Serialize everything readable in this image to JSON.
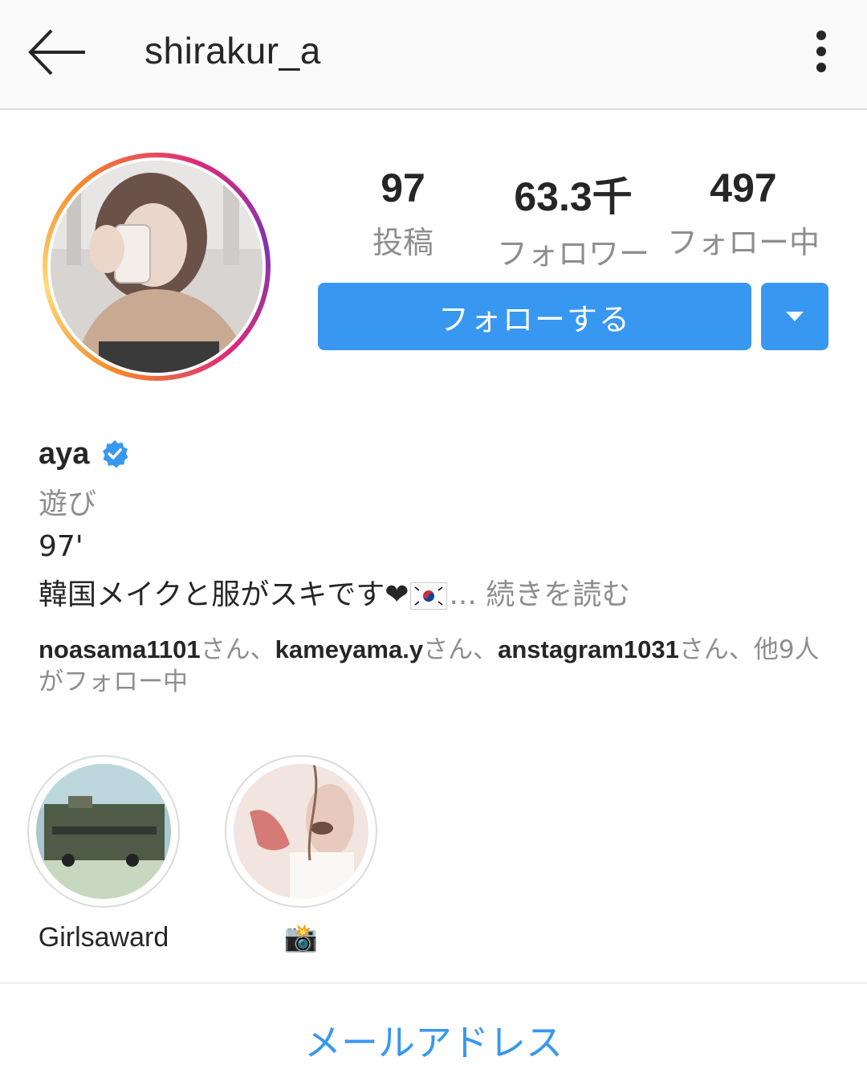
{
  "header": {
    "username": "shirakur_a",
    "back_icon": "back-arrow-icon",
    "more_icon": "more-vertical-icon"
  },
  "stats": {
    "posts": {
      "value": "97",
      "label": "投稿"
    },
    "followers": {
      "value": "63.3千",
      "label": "フォロワー"
    },
    "following": {
      "value": "497",
      "label": "フォロー中"
    }
  },
  "actions": {
    "follow_label": "フォローする",
    "dropdown_icon": "caret-down-icon"
  },
  "bio": {
    "name": "aya",
    "category": "遊び",
    "line1": "97'",
    "line2": "韓国メイクと服がスキです",
    "line2_ellipsis": "...",
    "more_label": "続きを読む",
    "followed_by": {
      "user1": "noasama1101",
      "suffix1": "さん、",
      "user2": "kameyama.y",
      "suffix2": "さん、",
      "user3": "anstagram1031",
      "tail": "さん、他9人がフォロー中"
    }
  },
  "highlights": [
    {
      "label": "Girlsaward"
    },
    {
      "label": "📸"
    }
  ],
  "footer": {
    "email_label": "メールアドレス"
  },
  "colors": {
    "accent": "#3897f0",
    "text": "#262626",
    "muted": "#8e8e8e"
  }
}
